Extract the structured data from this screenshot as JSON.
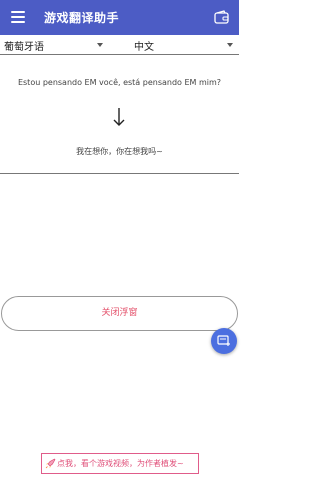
{
  "app": {
    "title": "游戏翻译助手"
  },
  "languages": {
    "source": "葡萄牙语",
    "target": "中文"
  },
  "translation": {
    "source_text": "Estou pensando EM você, está pensando EM mim?",
    "target_text": "我在想你，你在想我吗~"
  },
  "actions": {
    "close_float_label": "关闭浮窗"
  },
  "promo": {
    "text": "点我，看个游戏视频，为作者植发~"
  },
  "colors": {
    "primary": "#4c5cc5",
    "accent_pink": "#e3506a",
    "fab": "#4c6fe0"
  },
  "icons": {
    "menu": "hamburger-menu-icon",
    "top_right": "wallet-icon",
    "arrow": "arrow-down-icon",
    "fab": "add-window-icon",
    "promo": "rocket-icon"
  }
}
